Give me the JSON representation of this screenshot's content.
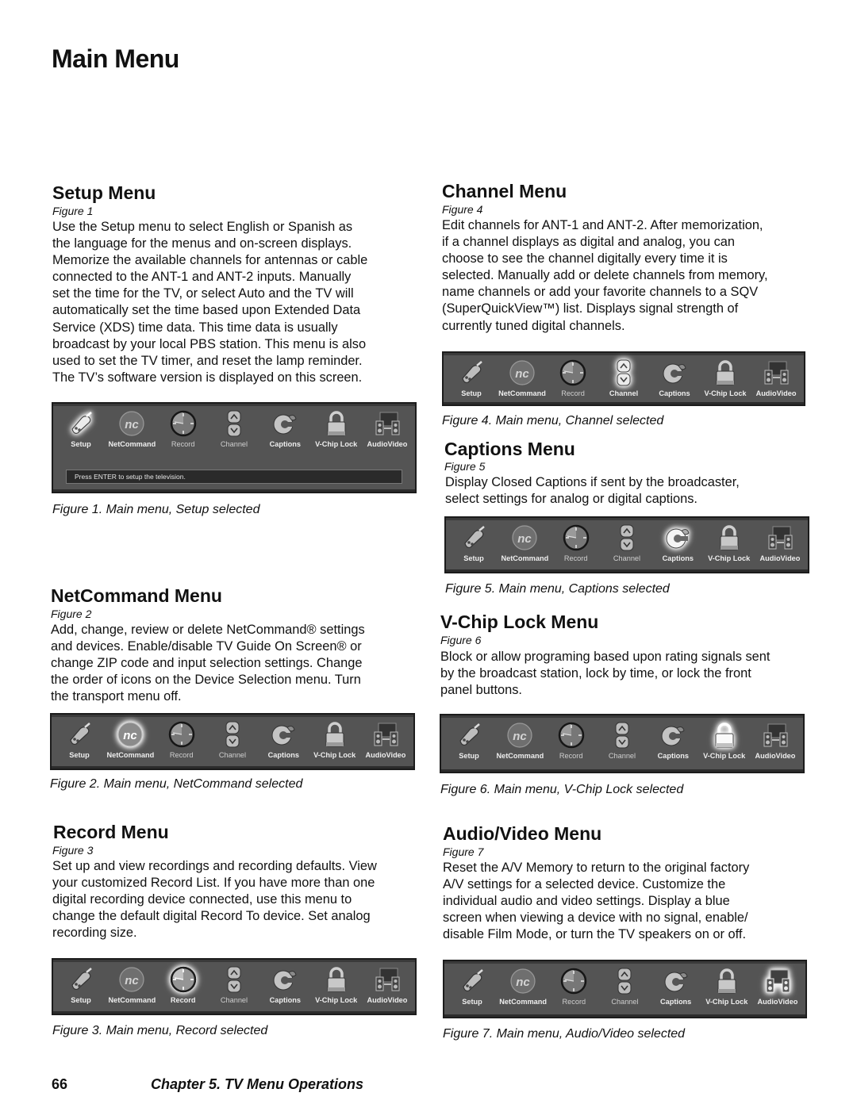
{
  "page": {
    "title": "Main Menu",
    "page_number": "66",
    "chapter": "Chapter 5. TV Menu Operations"
  },
  "menu_items": [
    "Setup",
    "NetCommand",
    "Record",
    "Channel",
    "Captions",
    "V-Chip Lock",
    "AudioVideo"
  ],
  "menu_icons": [
    "plug-icon",
    "netcommand-logo-icon",
    "clock-icon",
    "up-down-arrows-icon",
    "captions-icon",
    "padlock-icon",
    "tv-speakers-icon"
  ],
  "sections": {
    "setup": {
      "title": "Setup Menu",
      "figure_ref": "Figure 1",
      "body": "Use the Setup menu to select English or Spanish as\nthe language for the menus and on-screen displays.\nMemorize the available channels for antennas or cable\nconnected to the ANT-1 and ANT-2 inputs.  Manually\nset the time for the TV, or select Auto and the TV will\nautomatically set the time based upon Extended Data\nService (XDS) time data.  This time data is usually\nbroadcast by your local PBS station. This menu is also\nused to set the TV timer, and reset the lamp reminder.\nThe TV’s software version is displayed on this screen.",
      "status_text": "Press ENTER to setup the television.",
      "selected": "Setup",
      "caption": "Figure 1. Main menu, Setup selected"
    },
    "netcommand": {
      "title": "NetCommand Menu",
      "figure_ref": "Figure 2",
      "body": "Add, change, review or delete NetCommand® settings\nand devices.  Enable/disable TV Guide On Screen® or\nchange ZIP code and input selection settings.  Change\nthe order of icons on the Device Selection menu.  Turn\nthe transport menu off.",
      "selected": "NetCommand",
      "caption": "Figure 2. Main menu, NetCommand selected"
    },
    "record": {
      "title": "Record Menu",
      "figure_ref": "Figure 3",
      "body": "Set up and view recordings and recording defaults. View\nyour customized Record List. If you have more than one\ndigital recording device connected, use this menu to\nchange the default digital Record To device.  Set analog\nrecording size.",
      "selected": "Record",
      "caption": "Figure 3. Main menu, Record selected"
    },
    "channel": {
      "title": "Channel Menu",
      "figure_ref": "Figure 4",
      "body": "Edit channels for ANT-1 and ANT-2.  After memorization,\nif a channel displays as digital and analog, you can\nchoose to see the channel digitally every time it is\nselected.  Manually add or delete channels from memory,\nname channels or add your favorite channels to a SQV\n(SuperQuickView™) list.  Displays signal strength of\ncurrently tuned digital channels.",
      "selected": "Channel",
      "caption": "Figure 4. Main menu, Channel selected"
    },
    "captions": {
      "title": "Captions Menu",
      "figure_ref": "Figure 5",
      "body": "Display Closed Captions if sent by the broadcaster,\nselect settings for analog or digital captions.",
      "selected": "Captions",
      "caption": "Figure 5. Main menu, Captions selected"
    },
    "vchip": {
      "title": "V-Chip Lock Menu",
      "figure_ref": "Figure 6",
      "body": "Block or allow programing based upon rating signals sent\nby the broadcast station, lock by time, or lock the front\npanel buttons.",
      "selected": "V-Chip Lock",
      "caption": "Figure 6. Main menu, V-Chip Lock selected"
    },
    "audiovideo": {
      "title": "Audio/Video Menu",
      "figure_ref": "Figure 7",
      "body": "Reset the A/V Memory to return to the original factory\nA/V settings for a selected device. Customize the\nindividual audio and video settings.  Display a blue\nscreen when viewing a device with no signal, enable/\ndisable Film Mode, or turn the TV speakers on or off.",
      "selected": "AudioVideo",
      "caption": "Figure 7. Main menu, Audio/Video selected"
    }
  },
  "colors": {
    "menubar_bg": "#545454",
    "menubar_border": "#1c1c1c",
    "label_text": "#eeeeee",
    "selected_glow": "#f0f0f0"
  }
}
